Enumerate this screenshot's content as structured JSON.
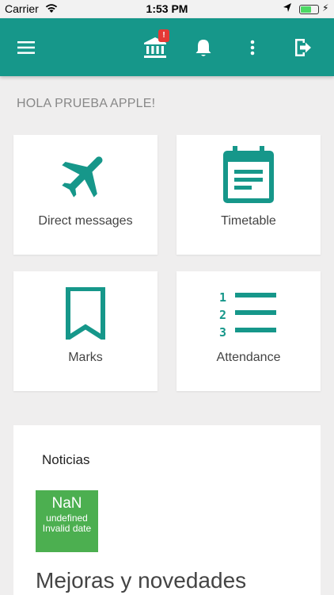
{
  "status_bar": {
    "carrier": "Carrier",
    "time": "1:53 PM",
    "battery_level": 0.6,
    "battery_color": "#4cd964"
  },
  "app_bar": {
    "background": "#16978a",
    "notification_badge": "!",
    "icons": [
      "menu-icon",
      "bank-icon",
      "bell-icon",
      "more-vertical-icon",
      "logout-icon"
    ]
  },
  "greeting": "HOLA PRUEBA APPLE!",
  "tiles": [
    {
      "label": "Direct messages",
      "icon": "airplane-icon"
    },
    {
      "label": "Timetable",
      "icon": "calendar-icon"
    },
    {
      "label": "Marks",
      "icon": "bookmark-icon"
    },
    {
      "label": "Attendance",
      "icon": "numbered-list-icon"
    }
  ],
  "accent_color": "#16978a",
  "news": {
    "title": "Noticias",
    "date_badge": {
      "day": "NaN",
      "month": "undefined",
      "year": "Invalid date",
      "color": "#4caf50"
    },
    "headline": "Mejoras y novedades"
  }
}
